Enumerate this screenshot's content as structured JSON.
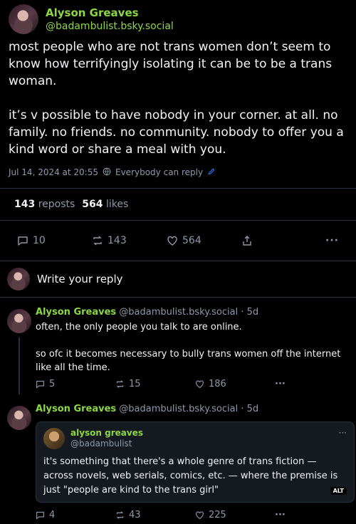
{
  "post": {
    "author_name": "Alyson Greaves",
    "author_handle": "@badambulist.bsky.social",
    "text": "most people who are not trans women don’t seem to know how terrifyingly isolating it can be to be a trans woman.\n\nit’s v possible to have nobody in your corner. at all. no family. no friends. no community. nobody to offer you a kind word or share a meal with you.",
    "timestamp": "Jul 14, 2024 at 20:55",
    "audience": "Everybody can reply",
    "reposts_count": "143",
    "reposts_label": "reposts",
    "likes_count": "564",
    "likes_label": "likes",
    "replies": "10",
    "reposts": "143",
    "likes": "564"
  },
  "reply_box": {
    "placeholder": "Write your reply"
  },
  "replies": [
    {
      "author_name": "Alyson Greaves",
      "author_handle": "@badambulist.bsky.social · 5d",
      "text": "often, the only people you talk to are online.\n\nso ofc it becomes necessary to bully trans women off the internet like all the time.",
      "replies": "5",
      "reposts": "15",
      "likes": "186"
    },
    {
      "author_name": "Alyson Greaves",
      "author_handle": "@badambulist.bsky.social · 5d",
      "quote": {
        "name": "alyson greaves",
        "handle": "@badambulist",
        "text": "it's something that there's a whole genre of trans fiction — across novels, web serials, comics, etc. — where the premise is just \"people are kind to the trans girl\"",
        "alt_badge": "ALT"
      },
      "replies": "4",
      "reposts": "43",
      "likes": "225"
    }
  ],
  "icons": [
    "reply-icon",
    "repost-icon",
    "heart-icon",
    "share-icon",
    "more-icon",
    "globe-icon",
    "edit-icon"
  ],
  "colors": {
    "accent_green": "#8dd642",
    "link_blue": "#1d87ff",
    "background": "#000000"
  }
}
